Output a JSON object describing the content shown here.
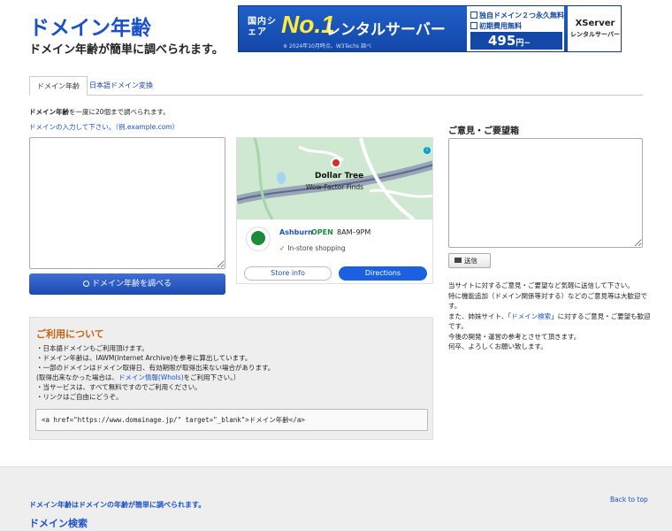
{
  "header": {
    "title": "ドメイン年齢",
    "subtitle": "ドメイン年齢が簡単に調べられます。"
  },
  "banner": {
    "share": "国内シェア",
    "no1": "No.1",
    "rental": "レンタルサーバー",
    "note": "※ 2024年10月時点、W3Techs 調べ",
    "feature1": "独自ドメイン２つ永久無料",
    "feature2": "初期費用無料",
    "price": "495",
    "price_unit": "円~",
    "logo": "XServer",
    "logo_sub": "レンタルサーバー"
  },
  "tabs": [
    {
      "label": "ドメイン年齢"
    },
    {
      "label": "日本語ドメイン変換"
    }
  ],
  "form": {
    "desc_bold": "ドメイン年齢",
    "desc_rest": "を一度に20個まで調べられます。",
    "hint": "ドメインの入力して下さい。（例.example.com）",
    "search_label": "ドメイン年齢を調べる"
  },
  "ad": {
    "store_name": "Dollar Tree",
    "store_tagline": "Wow-Factor Finds",
    "city": "Ashburn",
    "open": "OPEN",
    "hours": "8AM–9PM",
    "instore": "In-store shopping",
    "store_info": "Store info",
    "directions": "Directions",
    "info_icon": "i"
  },
  "feedback": {
    "title": "ご意見・ご要望箱",
    "send_label": "送信",
    "line1": "当サイトに対するご意見・ご要望など気軽に送信して下さい。",
    "line2": "特に機能追加（ドメイン関係等対する）などのご意見等は大歓迎です。",
    "line3_pre": "また、姉妹サイト、「",
    "line3_link": "ドメイン検索",
    "line3_post": "」に対するご意見・ご要望も歓迎です。",
    "line4": "今後の開発・運営の参考とさせて頂きます。",
    "line5": "何卒、よろしくお願い致します。"
  },
  "usage": {
    "title": "ご利用について",
    "item1": "・日本語ドメインもご利用頂けます。",
    "item2": "・ドメイン年齢は、IAWM(Internet Archive)を参考に算出しています。",
    "item3": "・一部のドメインはドメイン取得日、有効期限が取得出来ない場合があります。",
    "item4_pre": "(取得出来なかった場合は、",
    "item4_link": "ドメイン情報(WhoIs)",
    "item4_post": "をご利用下さい。）",
    "item5": "・当サービスは、すべて無料ですのでご利用ください。",
    "item6": "・リンクはご自由にどうぞ。",
    "code": "<a href=\"https://www.domainage.jp/\" target=\"_blank\">ドメイン年齢</a>"
  },
  "footer": {
    "text": "ドメイン年齢はドメインの年齢が簡単に調べられます。",
    "back_to_top": "Back to top",
    "heading": "ドメイン検索"
  }
}
